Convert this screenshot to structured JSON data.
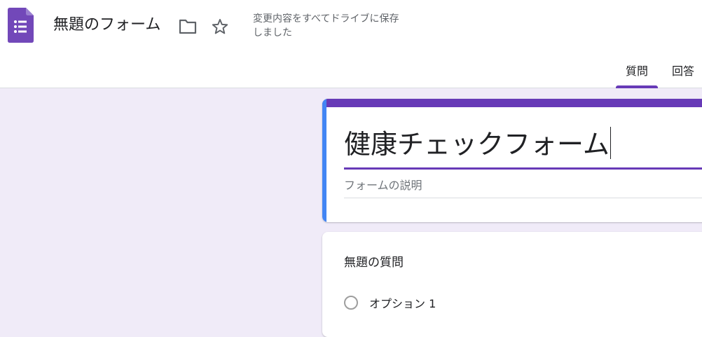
{
  "header": {
    "form_doc_title": "無題のフォーム",
    "save_status": "変更内容をすべてドライブに保存しました",
    "icons": [
      "forms-app-icon",
      "folder-icon",
      "star-icon"
    ]
  },
  "tabs": [
    {
      "label": "質問",
      "active": true
    },
    {
      "label": "回答",
      "active": false
    }
  ],
  "form": {
    "title": "健康チェックフォーム",
    "description_placeholder": "フォームの説明"
  },
  "question": {
    "title": "無題の質問",
    "options": [
      "オプション 1"
    ]
  },
  "colors": {
    "accent": "#673ab7",
    "background": "#f0ebf8",
    "focus_bar": "#4285f4"
  }
}
